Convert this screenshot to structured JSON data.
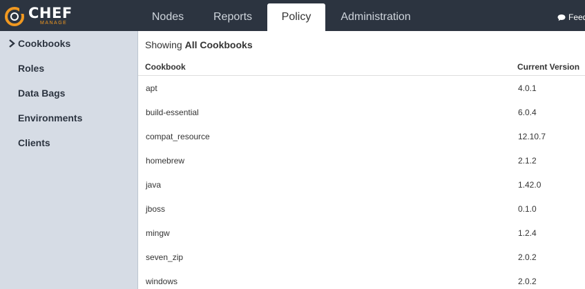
{
  "brand": {
    "wordmark": "CHEF",
    "subtitle": "MANAGE",
    "accent": "#f09820"
  },
  "nav": {
    "tabs": [
      {
        "label": "Nodes",
        "active": false
      },
      {
        "label": "Reports",
        "active": false
      },
      {
        "label": "Policy",
        "active": true
      },
      {
        "label": "Administration",
        "active": false
      }
    ],
    "feedback_label": "Feedback"
  },
  "sidebar": {
    "items": [
      {
        "label": "Cookbooks",
        "selected": true
      },
      {
        "label": "Roles"
      },
      {
        "label": "Data Bags"
      },
      {
        "label": "Environments"
      },
      {
        "label": "Clients"
      }
    ]
  },
  "main": {
    "showing_prefix": "Showing",
    "showing_value": "All Cookbooks",
    "columns": [
      "Cookbook",
      "Current Version"
    ],
    "rows": [
      {
        "name": "apt",
        "version": "4.0.1"
      },
      {
        "name": "build-essential",
        "version": "6.0.4"
      },
      {
        "name": "compat_resource",
        "version": "12.10.7"
      },
      {
        "name": "homebrew",
        "version": "2.1.2"
      },
      {
        "name": "java",
        "version": "1.42.0"
      },
      {
        "name": "jboss",
        "version": "0.1.0"
      },
      {
        "name": "mingw",
        "version": "1.2.4"
      },
      {
        "name": "seven_zip",
        "version": "2.0.2"
      },
      {
        "name": "windows",
        "version": "2.0.2"
      }
    ]
  },
  "colors": {
    "topbar": "#2c3440",
    "sidebar": "#d6dce5",
    "active_tab": "#ffffff"
  }
}
